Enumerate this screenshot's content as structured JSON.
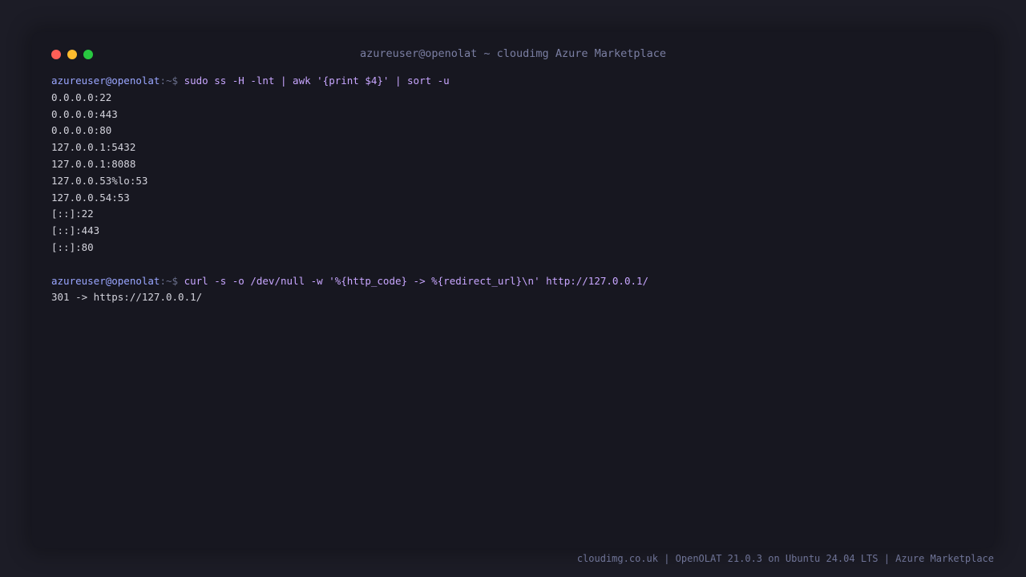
{
  "window": {
    "title": "azureuser@openolat ~ cloudimg Azure Marketplace"
  },
  "terminal": {
    "prompt_user": "azureuser@openolat",
    "prompt_path": ":~$",
    "commands": [
      {
        "command": "sudo ss -H -lnt | awk '{print $4}' | sort -u",
        "output": [
          "0.0.0.0:22",
          "0.0.0.0:443",
          "0.0.0.0:80",
          "127.0.0.1:5432",
          "127.0.0.1:8088",
          "127.0.0.53%lo:53",
          "127.0.0.54:53",
          "[::]:22",
          "[::]:443",
          "[::]:80"
        ]
      },
      {
        "command": "curl -s -o /dev/null -w '%{http_code} -> %{redirect_url}\\n' http://127.0.0.1/",
        "output": [
          "301 -> https://127.0.0.1/"
        ]
      }
    ]
  },
  "footer": {
    "text": "cloudimg.co.uk | OpenOLAT 21.0.3 on Ubuntu 24.04 LTS | Azure Marketplace"
  },
  "colors": {
    "background": "#1c1c26",
    "terminal_bg": "#171720",
    "prompt_user": "#9aa6ff",
    "command": "#c8a6ff",
    "output": "#d3d3dc",
    "close": "#ff5f57",
    "minimize": "#febc2e",
    "maximize": "#28c840"
  }
}
